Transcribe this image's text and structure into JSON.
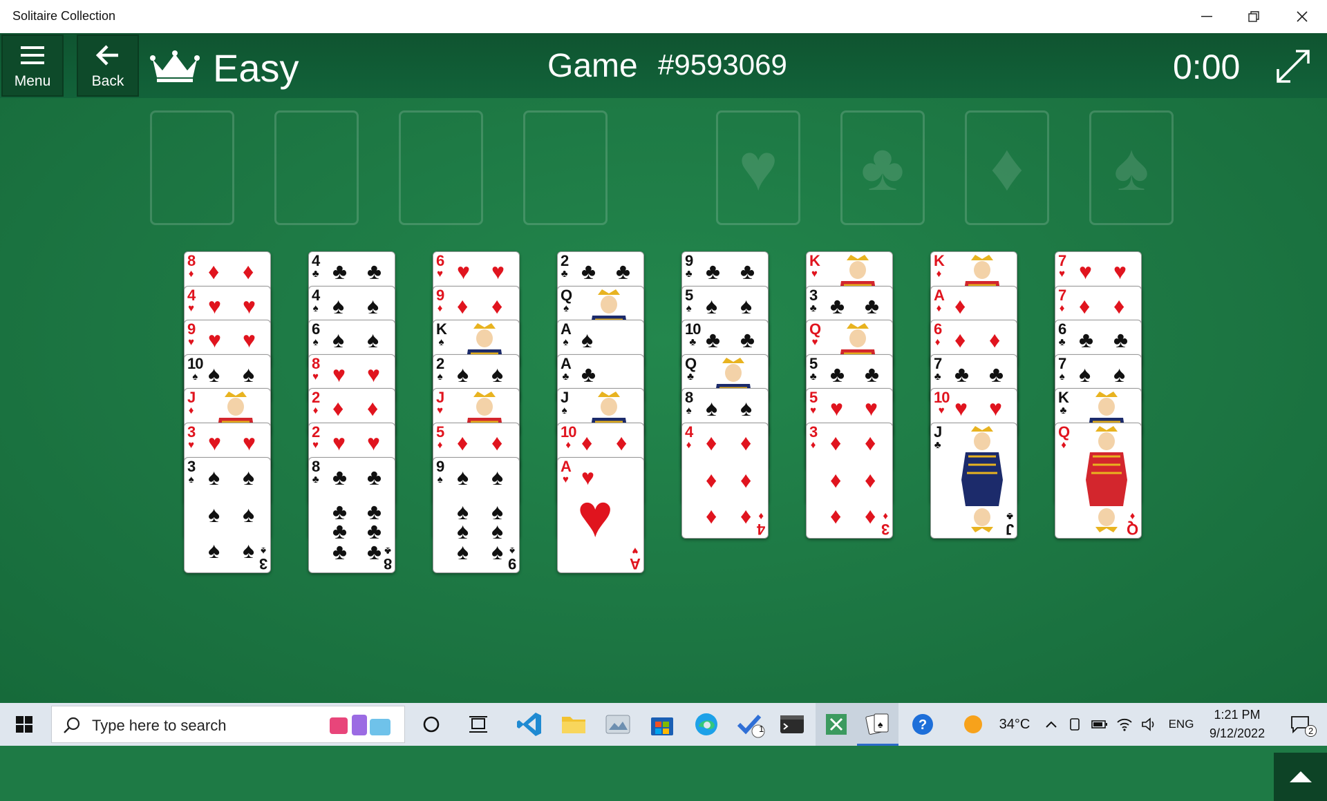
{
  "window": {
    "title": "Solitaire Collection"
  },
  "toolbar": {
    "menu_label": "Menu",
    "back_label": "Back",
    "difficulty": "Easy",
    "game_label": "Game",
    "game_number": "#9593069",
    "timer": "0:00"
  },
  "foundations": [
    "♥",
    "♣",
    "♦",
    "♠"
  ],
  "tableau": [
    [
      {
        "r": "8",
        "s": "♦"
      },
      {
        "r": "4",
        "s": "♥"
      },
      {
        "r": "9",
        "s": "♥"
      },
      {
        "r": "10",
        "s": "♠"
      },
      {
        "r": "J",
        "s": "♦"
      },
      {
        "r": "3",
        "s": "♥"
      },
      {
        "r": "3",
        "s": "♠"
      }
    ],
    [
      {
        "r": "4",
        "s": "♣"
      },
      {
        "r": "4",
        "s": "♠"
      },
      {
        "r": "6",
        "s": "♠"
      },
      {
        "r": "8",
        "s": "♥"
      },
      {
        "r": "2",
        "s": "♦"
      },
      {
        "r": "2",
        "s": "♥"
      },
      {
        "r": "8",
        "s": "♣"
      }
    ],
    [
      {
        "r": "6",
        "s": "♥"
      },
      {
        "r": "9",
        "s": "♦"
      },
      {
        "r": "K",
        "s": "♠"
      },
      {
        "r": "2",
        "s": "♠"
      },
      {
        "r": "J",
        "s": "♥"
      },
      {
        "r": "5",
        "s": "♦"
      },
      {
        "r": "9",
        "s": "♠"
      }
    ],
    [
      {
        "r": "2",
        "s": "♣"
      },
      {
        "r": "Q",
        "s": "♠"
      },
      {
        "r": "A",
        "s": "♠"
      },
      {
        "r": "A",
        "s": "♣"
      },
      {
        "r": "J",
        "s": "♠"
      },
      {
        "r": "10",
        "s": "♦"
      },
      {
        "r": "A",
        "s": "♥"
      }
    ],
    [
      {
        "r": "9",
        "s": "♣"
      },
      {
        "r": "5",
        "s": "♠"
      },
      {
        "r": "10",
        "s": "♣"
      },
      {
        "r": "Q",
        "s": "♣"
      },
      {
        "r": "8",
        "s": "♠"
      },
      {
        "r": "4",
        "s": "♦"
      }
    ],
    [
      {
        "r": "K",
        "s": "♥"
      },
      {
        "r": "3",
        "s": "♣"
      },
      {
        "r": "Q",
        "s": "♥"
      },
      {
        "r": "5",
        "s": "♣"
      },
      {
        "r": "5",
        "s": "♥"
      },
      {
        "r": "3",
        "s": "♦"
      }
    ],
    [
      {
        "r": "K",
        "s": "♦"
      },
      {
        "r": "A",
        "s": "♦"
      },
      {
        "r": "6",
        "s": "♦"
      },
      {
        "r": "7",
        "s": "♣"
      },
      {
        "r": "10",
        "s": "♥"
      },
      {
        "r": "J",
        "s": "♣"
      }
    ],
    [
      {
        "r": "7",
        "s": "♥"
      },
      {
        "r": "7",
        "s": "♦"
      },
      {
        "r": "6",
        "s": "♣"
      },
      {
        "r": "7",
        "s": "♠"
      },
      {
        "r": "K",
        "s": "♣"
      },
      {
        "r": "Q",
        "s": "♦"
      }
    ]
  ],
  "taskbar": {
    "search_placeholder": "Type here to search",
    "weather": "34°C",
    "language": "ENG",
    "time": "1:21 PM",
    "date": "9/12/2022",
    "badge_todo": "1",
    "badge_notifications": "2"
  },
  "colors": {
    "felt": "#1e7a45",
    "topbar": "#0f5430",
    "red_suit": "#e0141e",
    "black_suit": "#111111"
  }
}
